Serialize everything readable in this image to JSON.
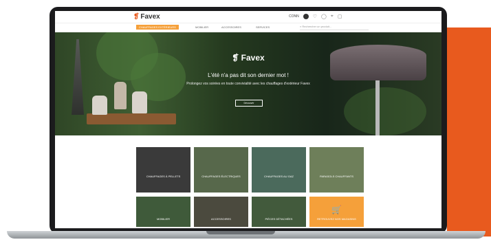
{
  "brand": {
    "logo": "Favex",
    "accent": "#e85a1e"
  },
  "topbar": {
    "account_label": "CONN"
  },
  "menu": [
    {
      "label": "CHAUFFAGES EXTÉRIEURS",
      "active": true
    },
    {
      "label": "MOBILIER",
      "active": false
    },
    {
      "label": "ACCESSOIRES",
      "active": false
    },
    {
      "label": "SERVICES",
      "active": false
    }
  ],
  "search": {
    "placeholder": "Rechercher un produit..."
  },
  "hero": {
    "logo": "Favex",
    "title": "L'été n'a pas dit son dernier mot !",
    "subtitle": "Prolongez vos soirées en toute convivialité avec les chauffages d'extérieur Favex",
    "cta": "Découvrir"
  },
  "tiles": [
    {
      "label": "CHAUFFAGES À PELLETS",
      "color": "#3a3a3a"
    },
    {
      "label": "CHAUFFAGES ÉLECTRIQUES",
      "color": "#57684b"
    },
    {
      "label": "CHAUFFAGES AU GAZ",
      "color": "#4b6a5c"
    },
    {
      "label": "PARASOLS CHAUFFANTS",
      "color": "#6e7f5a"
    },
    {
      "label": "MOBILIER",
      "color": "#3f5a3a"
    },
    {
      "label": "ACCESSOIRES",
      "color": "#4b4a3e"
    },
    {
      "label": "PIÈCES DÉTACHÉES",
      "color": "#425a3c"
    },
    {
      "label": "RETROUVEZ NOS MAGASINS",
      "color": "#f5a03a"
    }
  ]
}
